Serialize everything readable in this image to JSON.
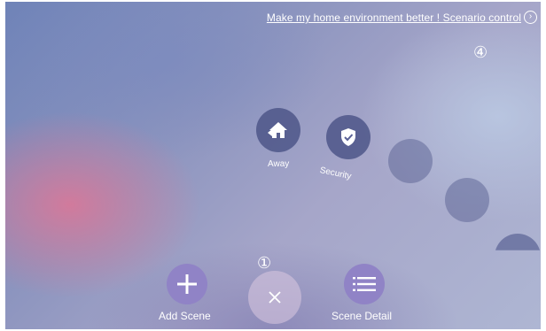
{
  "header": {
    "scenario_link": "Make my home environment better ! Scenario control",
    "arrow_icon": "chevron-right-circle-icon"
  },
  "annotations": {
    "one": "①",
    "four": "④"
  },
  "scenes": [
    {
      "label": "Away",
      "icon": "home-away-icon"
    },
    {
      "label": "Security",
      "icon": "shield-check-icon"
    }
  ],
  "bottom_bar": {
    "add_scene_label": "Add Scene",
    "scene_detail_label": "Scene Detail",
    "close_icon": "close-icon"
  },
  "colors": {
    "scene_circle": "#4e5688",
    "bottom_button": "#9083c6",
    "text": "#ffffff"
  }
}
